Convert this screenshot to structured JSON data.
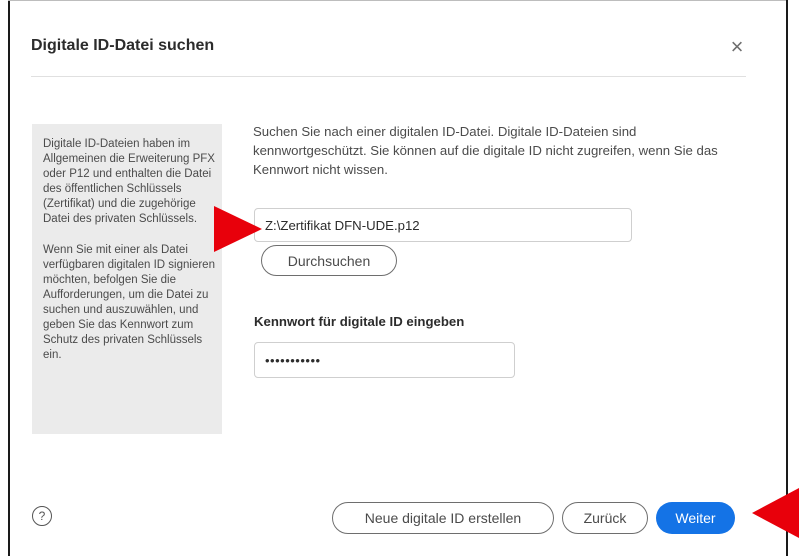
{
  "dialog": {
    "title": "Digitale ID-Datei suchen",
    "close_symbol": "×"
  },
  "sidebar": {
    "paragraph_1": "Digitale ID-Dateien haben im Allgemeinen die Erweiterung PFX oder P12 und enthalten die Datei des öffentlichen Schlüssels (Zertifikat) und die zugehörige Datei des privaten Schlüssels.",
    "paragraph_2": "Wenn Sie mit einer als Datei verfügbaren digitalen ID signieren möchten, befolgen Sie die Aufforderungen, um die Datei zu suchen und auszuwählen, und geben Sie das Kennwort zum Schutz des privaten Schlüssels ein."
  },
  "main": {
    "intro": "Suchen Sie nach einer digitalen ID-Datei. Digitale ID-Dateien sind kennwortgeschützt. Sie können auf die digitale ID nicht zugreifen, wenn Sie das Kennwort nicht wissen.",
    "file_path_value": "Z:\\Zertifikat DFN-UDE.p12",
    "browse_label": "Durchsuchen",
    "password_label": "Kennwort für digitale ID eingeben",
    "password_value": "•••••••••••"
  },
  "footer": {
    "help_symbol": "?",
    "new_id_label": "Neue digitale ID erstellen",
    "back_label": "Zurück",
    "next_label": "Weiter"
  },
  "colors": {
    "accent": "#1473e6",
    "annotation_arrow": "#e8000b",
    "sidebar_bg": "#ebebeb"
  },
  "icons": {
    "close": "close-icon",
    "help": "help-icon",
    "annotation": "arrow-pointer-icon"
  }
}
